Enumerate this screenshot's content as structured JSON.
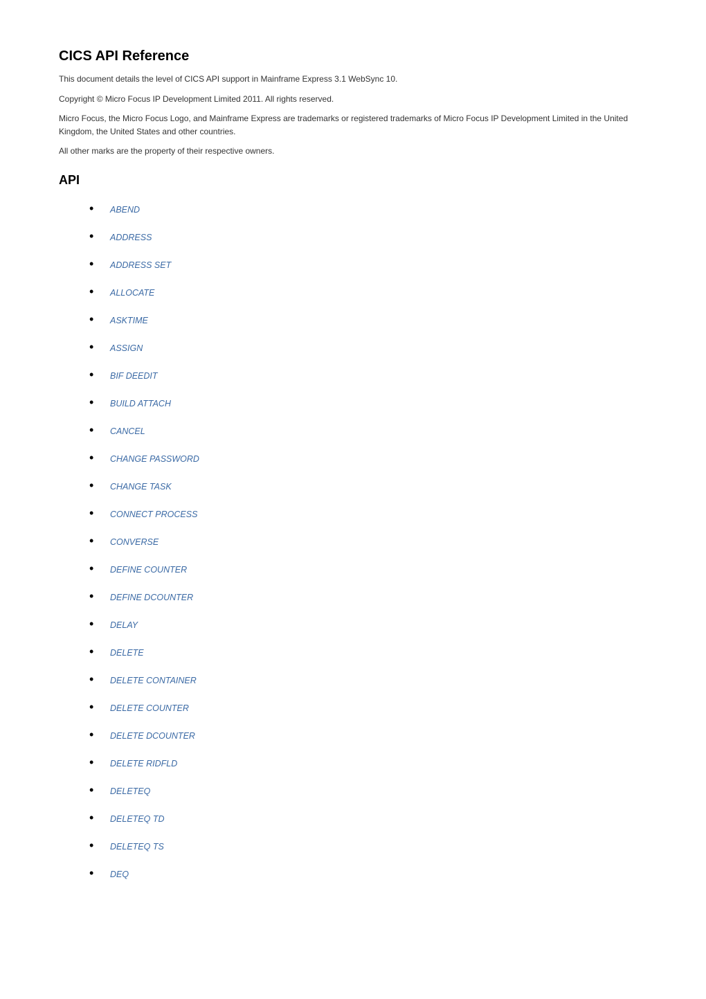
{
  "header": {
    "title": "CICS API Reference"
  },
  "intro": {
    "p1": "This document details the level of CICS API support in Mainframe Express 3.1 WebSync 10.",
    "p2": "Copyright © Micro Focus IP Development Limited 2011. All rights reserved.",
    "p3": "Micro Focus, the Micro Focus Logo, and Mainframe Express are trademarks or registered trademarks of Micro Focus IP Development Limited in the United Kingdom, the United States and other countries.",
    "p4": "All other marks are the property of their respective owners."
  },
  "section": {
    "heading": "API"
  },
  "api_items": {
    "0": "ABEND",
    "1": "ADDRESS",
    "2": "ADDRESS SET",
    "3": "ALLOCATE",
    "4": "ASKTIME",
    "5": "ASSIGN",
    "6": "BIF DEEDIT",
    "7": "BUILD ATTACH",
    "8": "CANCEL",
    "9": "CHANGE PASSWORD",
    "10": "CHANGE TASK",
    "11": "CONNECT PROCESS",
    "12": "CONVERSE",
    "13": "DEFINE COUNTER",
    "14": "DEFINE DCOUNTER",
    "15": "DELAY",
    "16": "DELETE",
    "17": "DELETE CONTAINER",
    "18": "DELETE COUNTER",
    "19": "DELETE DCOUNTER",
    "20": "DELETE RIDFLD",
    "21": "DELETEQ",
    "22": "DELETEQ TD",
    "23": "DELETEQ TS",
    "24": "DEQ"
  }
}
